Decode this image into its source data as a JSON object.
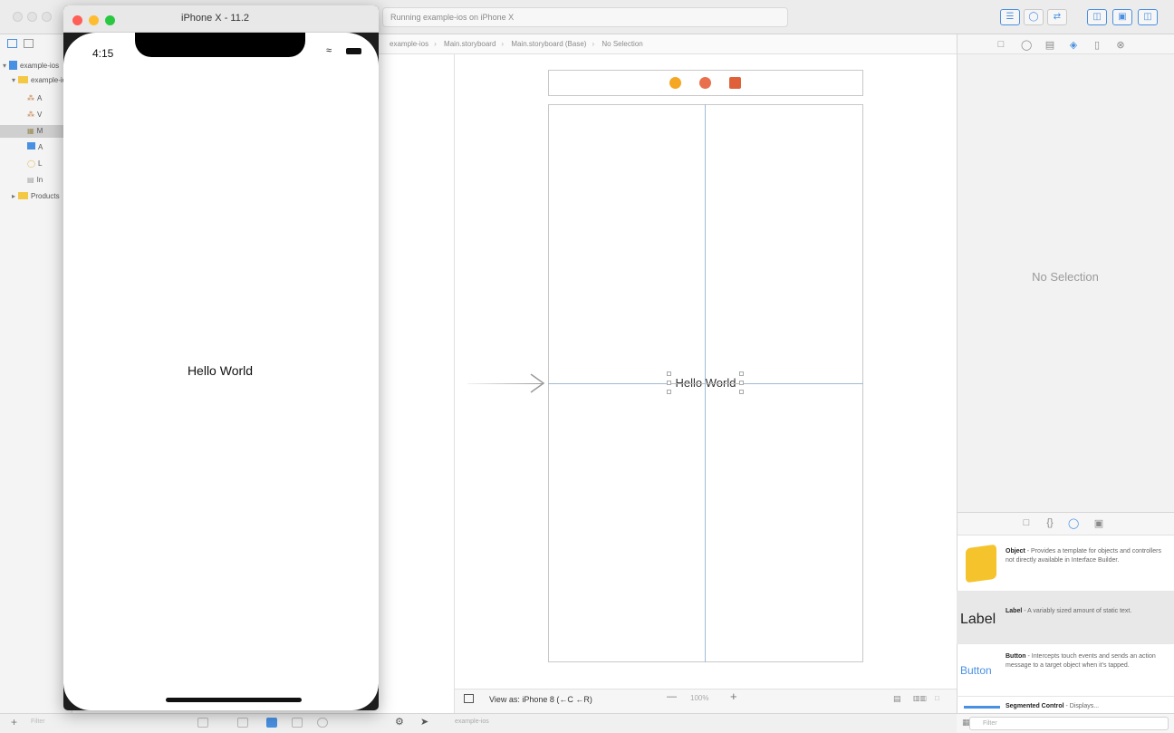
{
  "xcode": {
    "activity_text": "Running example-ios on iPhone X",
    "jumpbar": {
      "crumbs": [
        "example-ios",
        "Main.storyboard",
        "Main.storyboard (Base)",
        "No Selection"
      ]
    },
    "navigator_rows": [
      "example-ios",
      "example-ios",
      "A",
      "V",
      "M",
      "A",
      "L",
      "In",
      "Products"
    ],
    "canvas": {
      "label_text": "Hello World",
      "view_as": "View as: iPhone 8 (←C ←R)",
      "zoom": "100%"
    },
    "inspector": {
      "empty_text": "No Selection"
    },
    "library": {
      "items": [
        {
          "preview": "",
          "title": "Object",
          "desc": "- Provides a template for objects and controllers not directly available in Interface Builder."
        },
        {
          "preview": "Label",
          "title": "Label",
          "desc": "- A variably sized amount of static text."
        },
        {
          "preview": "Button",
          "title": "Button",
          "desc": "- Intercepts touch events and sends an action message to a target object when it's tapped."
        },
        {
          "preview": "",
          "title": "Segmented Control",
          "desc": "- Displays..."
        }
      ],
      "filter_placeholder": "Filter"
    },
    "status": {
      "scheme_text": "example-ios",
      "filter_placeholder": "Filter"
    }
  },
  "simulator": {
    "title": "iPhone X - 11.2",
    "time": "4:15",
    "label": "Hello World"
  },
  "colors": {
    "accent": "#4a90e2",
    "light_red": "#ff5f57",
    "light_yellow": "#febc2e",
    "light_green": "#28c840",
    "dock_yellow": "#f5a623",
    "dock_orange": "#e8704d",
    "dock_red": "#e0603a",
    "object_cube": "#f5c32c"
  }
}
